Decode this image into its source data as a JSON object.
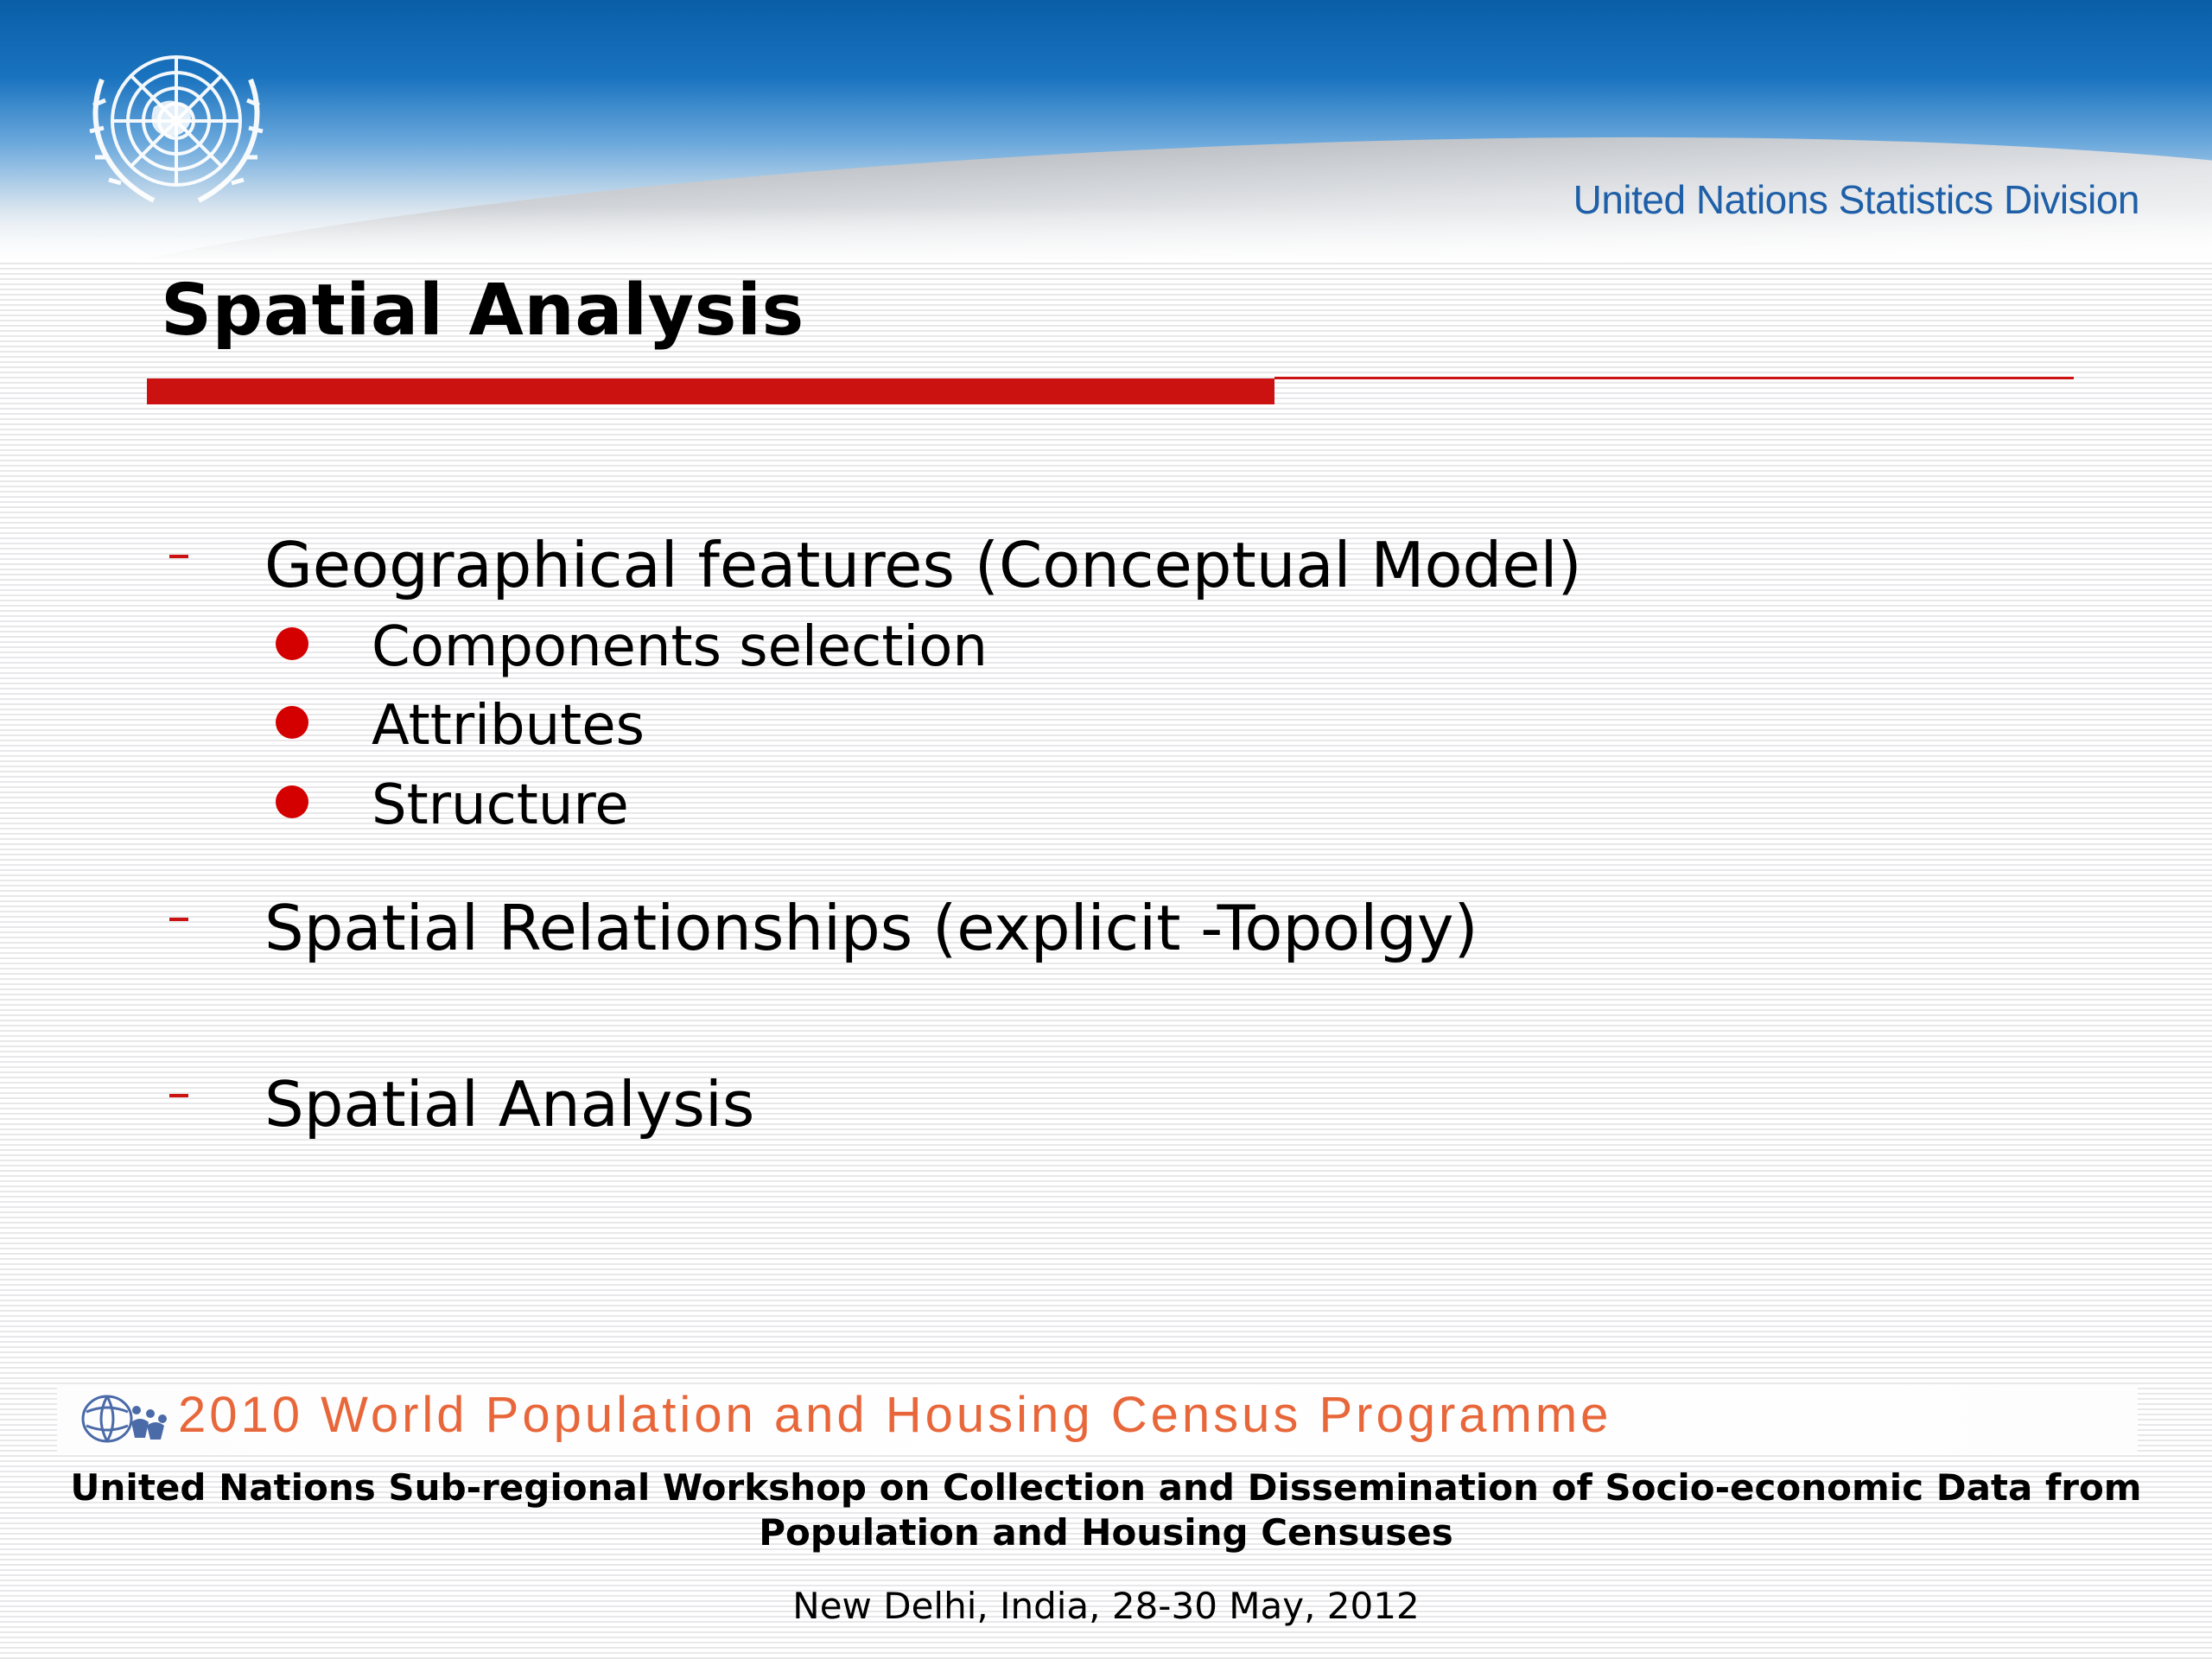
{
  "header": {
    "org_name": "United Nations Statistics Division",
    "logo_icon": "un-emblem-icon",
    "colors": {
      "header_blue": "#0a5ea8",
      "org_text": "#1e5fa8"
    }
  },
  "slide": {
    "title": "Spatial Analysis",
    "accent_color": "#cc1111",
    "bullets": [
      {
        "label": "Geographical features (Conceptual Model)",
        "sub": [
          "Components selection",
          "Attributes",
          "Structure"
        ]
      },
      {
        "label": "Spatial Relationships (explicit -Topolgy)",
        "sub": []
      },
      {
        "label": "Spatial Analysis",
        "sub": []
      }
    ],
    "bullet_color": "#d40000"
  },
  "footer": {
    "programme_logo_icon": "census-programme-logo-icon",
    "programme": "2010 World Population and Housing Census Programme",
    "programme_color": "#e8673a",
    "workshop_line1": "United Nations Sub-regional Workshop on Collection and Dissemination of Socio-economic Data from",
    "workshop_line2": "Population and Housing Censuses",
    "location": "New Delhi, India, 28-30 May, 2012"
  }
}
